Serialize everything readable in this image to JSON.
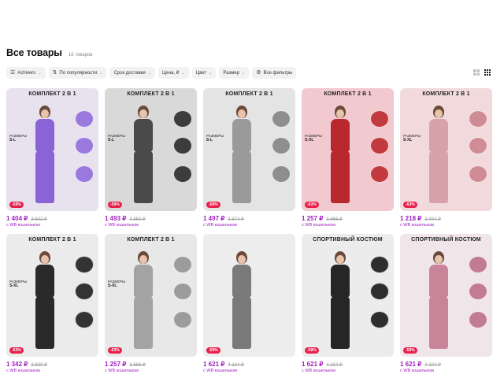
{
  "header": {
    "title": "Все товары",
    "count": "16 товаров"
  },
  "filters": [
    {
      "icon": "☰",
      "label": "Achivers",
      "icon_name": "list-icon",
      "name": "filter-brand"
    },
    {
      "icon": "⇅",
      "label": "По популярности",
      "icon_name": "sort-icon",
      "name": "filter-sort"
    },
    {
      "icon": "",
      "label": "Срок доставки",
      "icon_name": "",
      "name": "filter-delivery"
    },
    {
      "icon": "",
      "label": "Цена, ₽",
      "icon_name": "",
      "name": "filter-price"
    },
    {
      "icon": "",
      "label": "Цвет",
      "icon_name": "",
      "name": "filter-color"
    },
    {
      "icon": "",
      "label": "Размер",
      "icon_name": "",
      "name": "filter-size"
    },
    {
      "icon": "⚙",
      "label": "Все фильтры",
      "icon_name": "settings-icon",
      "name": "filter-all"
    }
  ],
  "colors": {
    "accent": "#a020c0",
    "discount": "#e8214c"
  },
  "products": [
    {
      "headline": "КОМПЛЕКТ 2 В 1",
      "sizes_label": "РАЗМЕРЫ",
      "sizes": "S-L",
      "discount": "-59%",
      "price": "1 404 ₽",
      "old_price": "3 632 ₽",
      "wallet": "с WB кошельком",
      "bg": "#e7e2ee",
      "outfit": "#8a64d6",
      "detail": "#9a78de"
    },
    {
      "headline": "КОМПЛЕКТ 2 В 1",
      "sizes_label": "РАЗМЕРЫ",
      "sizes": "S-L",
      "discount": "-59%",
      "price": "1 493 ₽",
      "old_price": "3 850 ₽",
      "wallet": "с WB кошельком",
      "bg": "#d9d9d9",
      "outfit": "#4a4a4a",
      "detail": "#3c3c3c"
    },
    {
      "headline": "КОМПЛЕКТ 2 В 1",
      "sizes_label": "РАЗМЕРЫ",
      "sizes": "S-L",
      "discount": "-59%",
      "price": "1 497 ₽",
      "old_price": "3 874 ₽",
      "wallet": "с WB кошельком",
      "bg": "#e4e4e4",
      "outfit": "#9a9a9a",
      "detail": "#8e8e8e"
    },
    {
      "headline": "КОМПЛЕКТ 2 В 1",
      "sizes_label": "РАЗМЕРЫ",
      "sizes": "S-XL",
      "discount": "-63%",
      "price": "1 257 ₽",
      "old_price": "3 666 ₽",
      "wallet": "с WB кошельком",
      "bg": "#f2c9cf",
      "outfit": "#b8282e",
      "detail": "#c23a3f"
    },
    {
      "headline": "КОМПЛЕКТ 2 В 1",
      "sizes_label": "РАЗМЕРЫ",
      "sizes": "S-XL",
      "discount": "-63%",
      "price": "1 218 ₽",
      "old_price": "3 404 ₽",
      "wallet": "с WB кошельком",
      "bg": "#f1d9dc",
      "outfit": "#d9a1a9",
      "detail": "#d08c96"
    },
    {
      "headline": "КОМПЛЕКТ 2 В 1",
      "sizes_label": "РАЗМЕРЫ",
      "sizes": "S-XL",
      "discount": "-63%",
      "price": "1 342 ₽",
      "old_price": "3 630 ₽",
      "wallet": "с WB кошельком",
      "bg": "#ebebeb",
      "outfit": "#2a2a2a",
      "detail": "#333333"
    },
    {
      "headline": "КОМПЛЕКТ 2 В 1",
      "sizes_label": "РАЗМЕРЫ",
      "sizes": "S-XL",
      "discount": "-63%",
      "price": "1 257 ₽",
      "old_price": "3 666 ₽",
      "wallet": "с WB кошельком",
      "bg": "#e8e8e8",
      "outfit": "#a3a3a3",
      "detail": "#9c9c9c"
    },
    {
      "headline": "",
      "sizes_label": "",
      "sizes": "",
      "discount": "-59%",
      "price": "1 621 ₽",
      "old_price": "4 104 ₽",
      "wallet": "с WB кошельком",
      "bg": "#ededed",
      "outfit": "#7a7a7a",
      "detail": ""
    },
    {
      "headline": "СПОРТИВНЫЙ КОСТЮМ",
      "sizes_label": "",
      "sizes": "",
      "discount": "-59%",
      "price": "1 621 ₽",
      "old_price": "4 104 ₽",
      "wallet": "с WB кошельком",
      "bg": "#ececec",
      "outfit": "#262626",
      "detail": "#2e2e2e"
    },
    {
      "headline": "СПОРТИВНЫЙ КОСТЮМ",
      "sizes_label": "",
      "sizes": "",
      "discount": "-59%",
      "price": "1 621 ₽",
      "old_price": "4 104 ₽",
      "wallet": "с WB кошельком",
      "bg": "#f0e6ea",
      "outfit": "#c8859a",
      "detail": "#c27c92"
    }
  ]
}
